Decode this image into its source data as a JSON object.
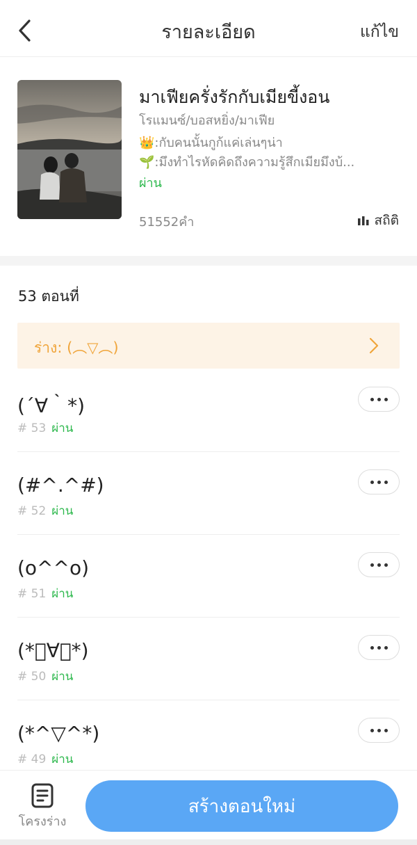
{
  "header": {
    "title": "รายละเอียด",
    "edit_label": "แก้ไข"
  },
  "book": {
    "title": "มาเฟียครั่งรักกับเมียขี้งอน",
    "genre": "โรแมนซ์/บอสหยิ่ง/มาเฟีย",
    "desc_line1": "👑:กับคนนั้นกูก้แค่เล่นๆน่า",
    "desc_line2": "🌱:มึงทำไรหัดคิดถึงความรู้สึกเมียมึงบ้...",
    "status": "ผ่าน",
    "word_count": "51552คำ",
    "stats_label": "สถิติ"
  },
  "chapters_count_label": "53 ตอนที่",
  "draft": {
    "label": "ร่าง: (︵▽︵)"
  },
  "chapters": [
    {
      "title": "(´∀｀*)",
      "number": "# 53",
      "status": "ผ่าน"
    },
    {
      "title": "(#^.^#)",
      "number": "# 52",
      "status": "ผ่าน"
    },
    {
      "title": "(o^^o)",
      "number": "# 51",
      "status": "ผ่าน"
    },
    {
      "title": "(*ﾟ∀ﾟ*)",
      "number": "# 50",
      "status": "ผ่าน"
    },
    {
      "title": "(*^▽^*)",
      "number": "# 49",
      "status": "ผ่าน"
    }
  ],
  "bottom": {
    "outline_label": "โครงร่าง",
    "create_label": "สร้างตอนใหม่"
  },
  "colors": {
    "accent_blue": "#5aa7f5",
    "status_green": "#2db84d",
    "draft_orange": "#f0a53b",
    "draft_bg": "#fdf3e6"
  },
  "icons": {
    "back": "back-arrow-icon",
    "stats": "bar-chart-icon",
    "draft_arrow": "chevron-right-icon",
    "more": "more-dots-icon",
    "outline": "outline-document-icon"
  }
}
